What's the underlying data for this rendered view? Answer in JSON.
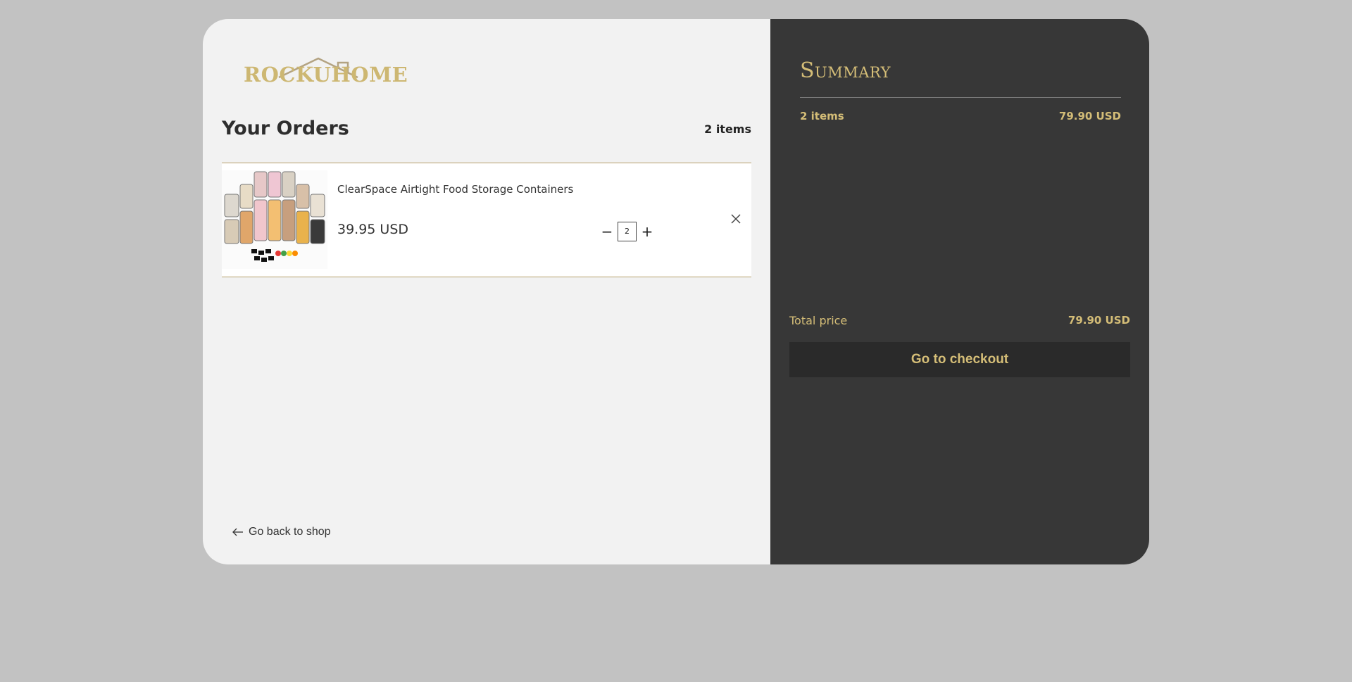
{
  "brand": {
    "name": "ROCKUHOME"
  },
  "orders": {
    "title": "Your Orders",
    "count_label": "2 items",
    "items": [
      {
        "name": "ClearSpace Airtight Food Storage Containers",
        "price": "39.95 USD",
        "quantity": "2",
        "image_icon": "food-storage-containers"
      }
    ]
  },
  "nav": {
    "back_label": "Go back to shop"
  },
  "summary": {
    "title": "Summary",
    "items_label": "2 items",
    "items_amount": "79.90 USD",
    "total_label": "Total price",
    "total_value": "79.90 USD",
    "checkout_label": "Go to checkout"
  },
  "colors": {
    "accent": "#d4bd77",
    "panel_dark": "#373737",
    "panel_light": "#f2f2f2",
    "page_bg": "#c2c2c2"
  }
}
